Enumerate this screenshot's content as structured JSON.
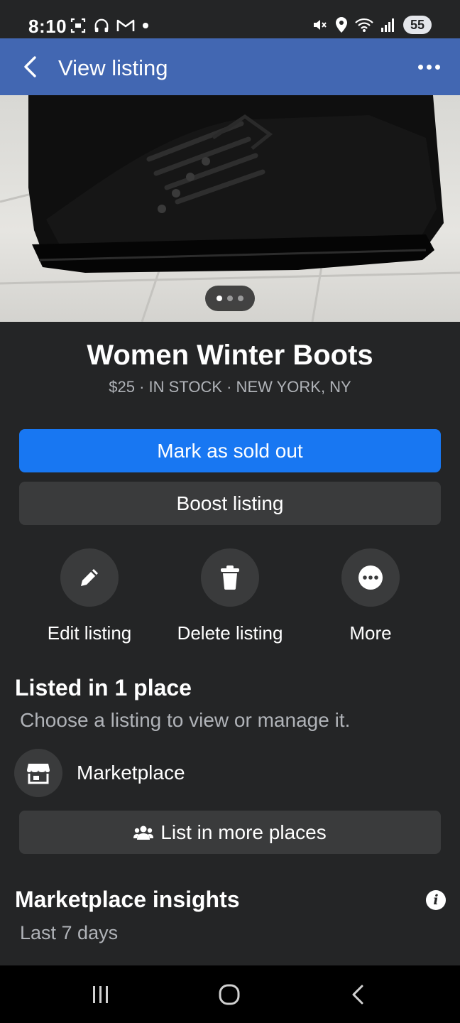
{
  "status_bar": {
    "time": "8:10",
    "battery": "55",
    "left_icons": [
      "screenshot-icon",
      "headphones-icon",
      "gmail-icon",
      "dot-icon"
    ],
    "right_icons": [
      "mute-icon",
      "location-icon",
      "wifi-icon",
      "signal-icon",
      "battery-icon"
    ]
  },
  "app_bar": {
    "title": "View listing",
    "back_icon": "back-arrow-icon",
    "menu_icon": "more-dots-icon"
  },
  "photo": {
    "subject": "black leather lace-up boots on tiled floor",
    "page_count": 3,
    "active_page": 1
  },
  "listing": {
    "title": "Women Winter Boots",
    "subtitle": "$25 · IN STOCK · NEW YORK, NY"
  },
  "buttons": {
    "mark_sold": "Mark as sold out",
    "boost": "Boost listing"
  },
  "actions": [
    {
      "label": "Edit listing",
      "icon": "pencil-icon"
    },
    {
      "label": "Delete listing",
      "icon": "trash-icon"
    },
    {
      "label": "More",
      "icon": "more-icon"
    }
  ],
  "listed": {
    "title": "Listed in 1 place",
    "subtitle": "Choose a listing to view or manage it.",
    "places": [
      {
        "label": "Marketplace",
        "icon": "storefront-icon"
      }
    ],
    "list_more": "List in more places"
  },
  "insights": {
    "title": "Marketplace insights",
    "subtitle": "Last 7 days"
  },
  "nav": [
    "recent-apps-icon",
    "home-icon",
    "back-icon"
  ],
  "colors": {
    "background": "#242526",
    "app_bar": "#4267b2",
    "primary_button": "#1877f2",
    "secondary_button": "#3a3b3c",
    "muted_text": "#b0b3b8"
  }
}
